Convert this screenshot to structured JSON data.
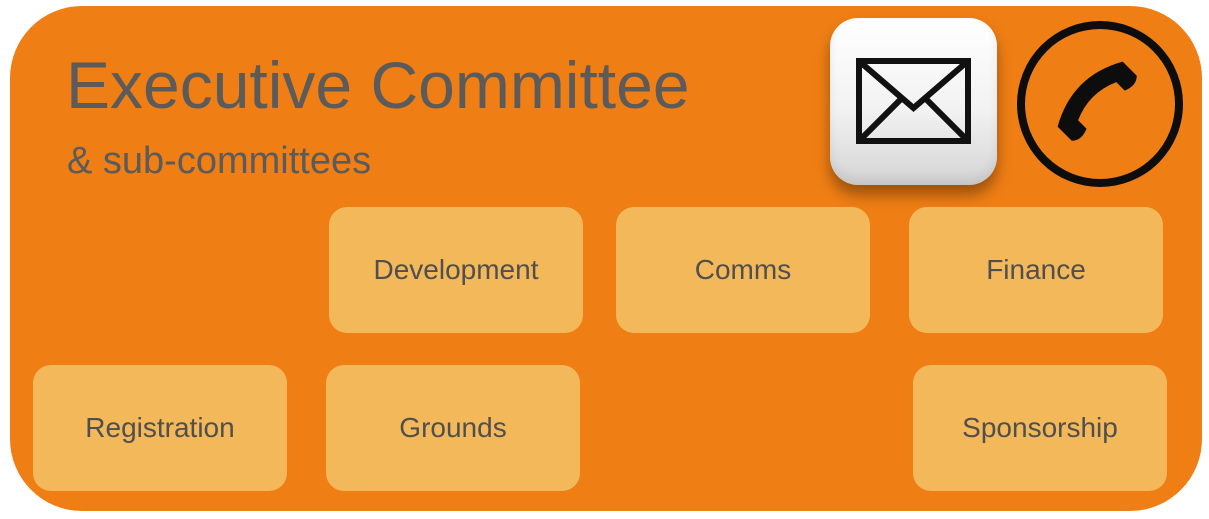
{
  "header": {
    "title": "Executive Committee",
    "subtitle": "& sub-committees"
  },
  "actions": {
    "mail_icon": "envelope-icon",
    "phone_icon": "phone-icon"
  },
  "subcommittees": [
    {
      "label": "Development"
    },
    {
      "label": "Comms"
    },
    {
      "label": "Finance"
    },
    {
      "label": "Registration"
    },
    {
      "label": "Grounds"
    },
    {
      "label": "Sponsorship"
    }
  ],
  "colors": {
    "card_background": "#ef7e14",
    "tile_background": "#f3b85a",
    "text": "#5b5b5b"
  }
}
